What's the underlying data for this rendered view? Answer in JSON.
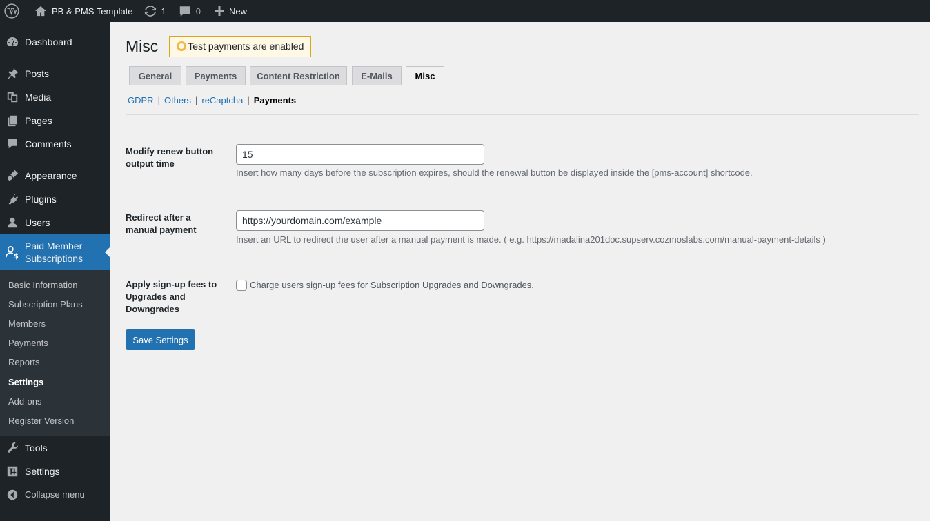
{
  "adminbar": {
    "site_name": "PB & PMS Template",
    "updates_count": "1",
    "comments_count": "0",
    "new_label": "New"
  },
  "sidebar": {
    "items_top": [
      {
        "label": "Dashboard",
        "icon": "dashboard-icon"
      }
    ],
    "items_content": [
      {
        "label": "Posts",
        "icon": "pin-icon"
      },
      {
        "label": "Media",
        "icon": "media-icon"
      },
      {
        "label": "Pages",
        "icon": "pages-icon"
      },
      {
        "label": "Comments",
        "icon": "comment-icon"
      }
    ],
    "items_admin": [
      {
        "label": "Appearance",
        "icon": "brush-icon"
      },
      {
        "label": "Plugins",
        "icon": "plug-icon"
      },
      {
        "label": "Users",
        "icon": "user-icon"
      }
    ],
    "current": {
      "label": "Paid Member Subscriptions",
      "icon": "member-dollar-icon"
    },
    "submenu": [
      "Basic Information",
      "Subscription Plans",
      "Members",
      "Payments",
      "Reports",
      "Settings",
      "Add-ons",
      "Register Version"
    ],
    "submenu_current": "Settings",
    "items_bottom": [
      {
        "label": "Tools",
        "icon": "wrench-icon"
      },
      {
        "label": "Settings",
        "icon": "sliders-icon"
      }
    ],
    "collapse_label": "Collapse menu"
  },
  "page": {
    "title": "Misc",
    "notice": "Test payments are enabled"
  },
  "tabs": [
    "General",
    "Payments",
    "Content Restriction",
    "E-Mails",
    "Misc"
  ],
  "tab_active": "Misc",
  "subtabs": [
    "GDPR",
    "Others",
    "reCaptcha",
    "Payments"
  ],
  "subtab_active": "Payments",
  "form": {
    "renew": {
      "label": "Modify renew button output time",
      "value": "15",
      "description": "Insert how many days before the subscription expires, should the renewal button be displayed inside the [pms-account] shortcode."
    },
    "redirect": {
      "label": "Redirect after a manual payment",
      "value": "https://yourdomain.com/example",
      "description": "Insert an URL to redirect the user after a manual payment is made. ( e.g. https://madalina201doc.supserv.cozmoslabs.com/manual-payment-details )"
    },
    "signup_fees": {
      "label": "Apply sign-up fees to Upgrades and Downgrades",
      "checkbox_label": "Charge users sign-up fees for Subscription Upgrades and Downgrades.",
      "checked": false
    },
    "save_label": "Save Settings"
  },
  "colors": {
    "adminbar_bg": "#1d2327",
    "accent": "#2271b1",
    "notice_border": "#dba617"
  }
}
